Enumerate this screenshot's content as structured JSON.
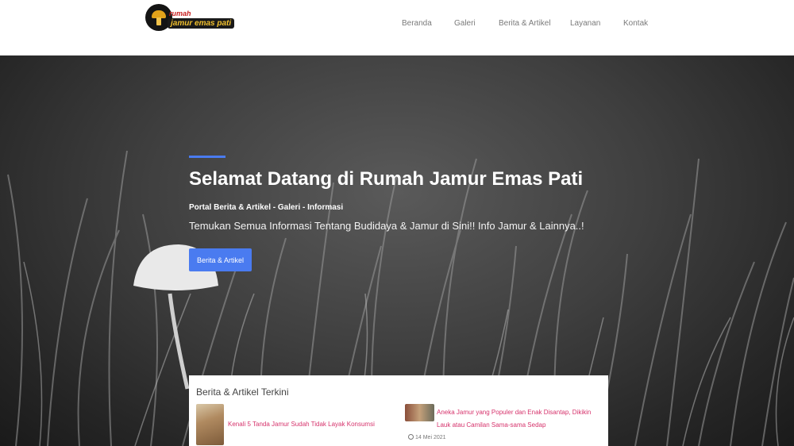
{
  "header": {
    "logo_small": "rumah",
    "logo_big": "jamur emas pati",
    "nav": [
      "Beranda",
      "Galeri",
      "Berita & Artikel",
      "Layanan",
      "Kontak"
    ]
  },
  "hero": {
    "title": "Selamat Datang di Rumah Jamur Emas Pati",
    "subtitle": "Portal Berita & Artikel - Galeri - Informasi",
    "description": "Temukan Semua Informasi Tentang Budidaya & Jamur di Sini!! Info Jamur & Lainnya..!",
    "button_label": "Berita & Artikel"
  },
  "news": {
    "heading": "Berita & Artikel Terkini",
    "items": [
      {
        "title": "Kenali 5 Tanda Jamur Sudah Tidak Layak Konsumsi"
      },
      {
        "title": "Aneka Jamur yang Populer dan Enak Disantap, Dikikin Lauk atau Camilan Sama-sama Sedap",
        "date": "14 Mei 2021"
      }
    ]
  },
  "colors": {
    "accent": "#4a7bf0",
    "link": "#d6336c"
  }
}
